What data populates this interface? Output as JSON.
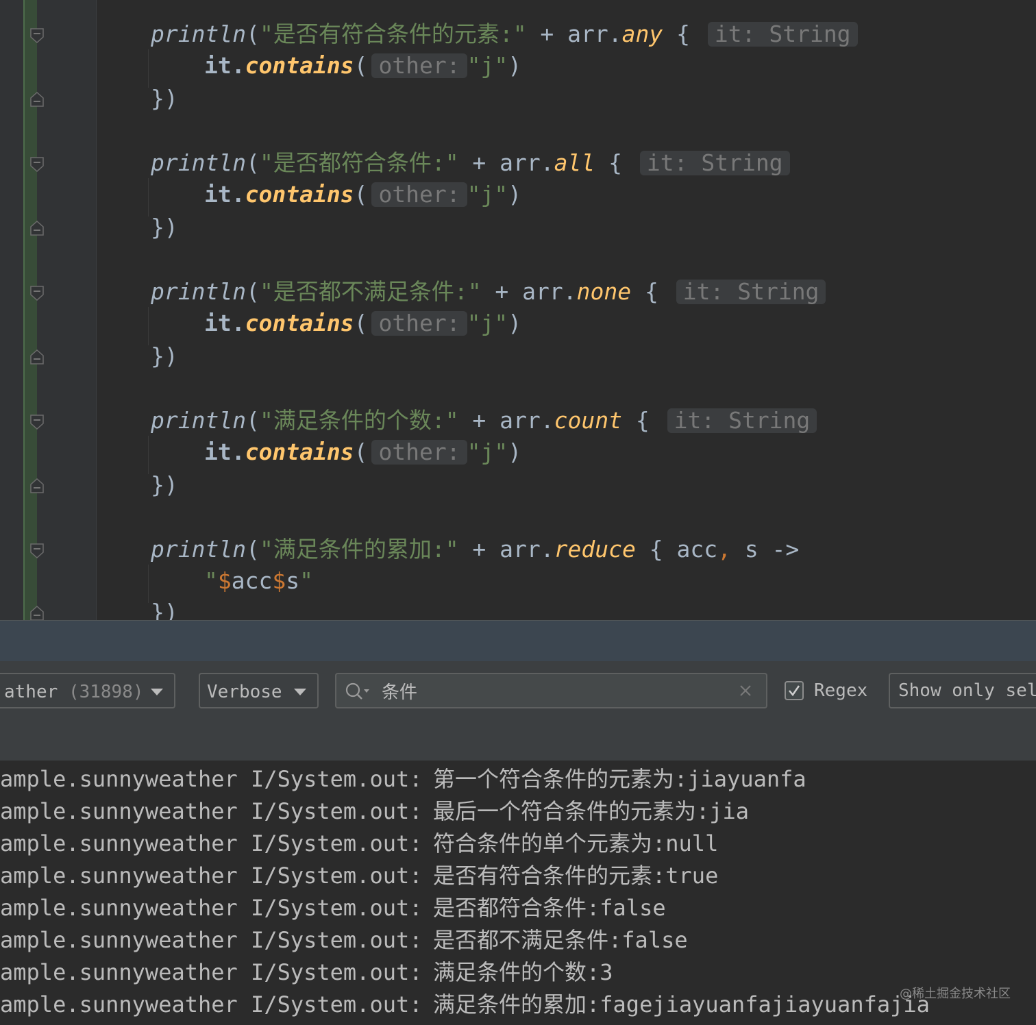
{
  "editor": {
    "blocks": [
      {
        "print": "println",
        "open": "(",
        "label": "\"是否有符合条件的元素:\"",
        "plus": " + arr.",
        "method": "any",
        "brace": " {",
        "hint": "it: String",
        "body_it": "it.",
        "body_fn": "contains",
        "body_open": "(",
        "body_hint": "other:",
        "body_arg": "\"j\"",
        "body_close": ")",
        "close": "})"
      },
      {
        "print": "println",
        "open": "(",
        "label": "\"是否都符合条件:\"",
        "plus": " + arr.",
        "method": "all",
        "brace": " {",
        "hint": "it: String",
        "body_it": "it.",
        "body_fn": "contains",
        "body_open": "(",
        "body_hint": "other:",
        "body_arg": "\"j\"",
        "body_close": ")",
        "close": "})"
      },
      {
        "print": "println",
        "open": "(",
        "label": "\"是否都不满足条件:\"",
        "plus": " + arr.",
        "method": "none",
        "brace": " {",
        "hint": "it: String",
        "body_it": "it.",
        "body_fn": "contains",
        "body_open": "(",
        "body_hint": "other:",
        "body_arg": "\"j\"",
        "body_close": ")",
        "close": "})"
      },
      {
        "print": "println",
        "open": "(",
        "label": "\"满足条件的个数:\"",
        "plus": " + arr.",
        "method": "count",
        "brace": " {",
        "hint": "it: String",
        "body_it": "it.",
        "body_fn": "contains",
        "body_open": "(",
        "body_hint": "other:",
        "body_arg": "\"j\"",
        "body_close": ")",
        "close": "})"
      }
    ],
    "reduce_block": {
      "print": "println",
      "open": "(",
      "label": "\"满足条件的累加:\"",
      "plus": " + arr.",
      "method": "reduce",
      "brace": " { acc",
      "comma": ",",
      "params": " s ->",
      "body_q1": "\"",
      "body_d1": "$",
      "body_v1": "acc",
      "body_d2": "$",
      "body_v2": "s",
      "body_q2": "\"",
      "close": "})"
    }
  },
  "toolbar": {
    "process_name": "ather",
    "process_pid": "(31898)",
    "level": "Verbose",
    "search_value": "条件",
    "regex_label": "Regex",
    "regex_checked": true,
    "show_only_label": "Show only sele"
  },
  "log": {
    "tag": "ample.sunnyweather I/System.out:",
    "lines": [
      "第一个符合条件的元素为:jiayuanfa",
      "最后一个符合条件的元素为:jia",
      "符合条件的单个元素为:null",
      "是否有符合条件的元素:true",
      "是否都符合条件:false",
      "是否都不满足条件:false",
      "满足条件的个数:3",
      "满足条件的累加:fagejiayuanfajiayuanfajia"
    ]
  },
  "watermark": "@稀土掘金技术社区",
  "colors": {
    "editor_bg": "#2b2b2b",
    "string": "#6a8759",
    "function": "#ffc66d",
    "keyword": "#cc7832",
    "text": "#a9b7c6",
    "hint_bg": "#3b3d3f"
  }
}
